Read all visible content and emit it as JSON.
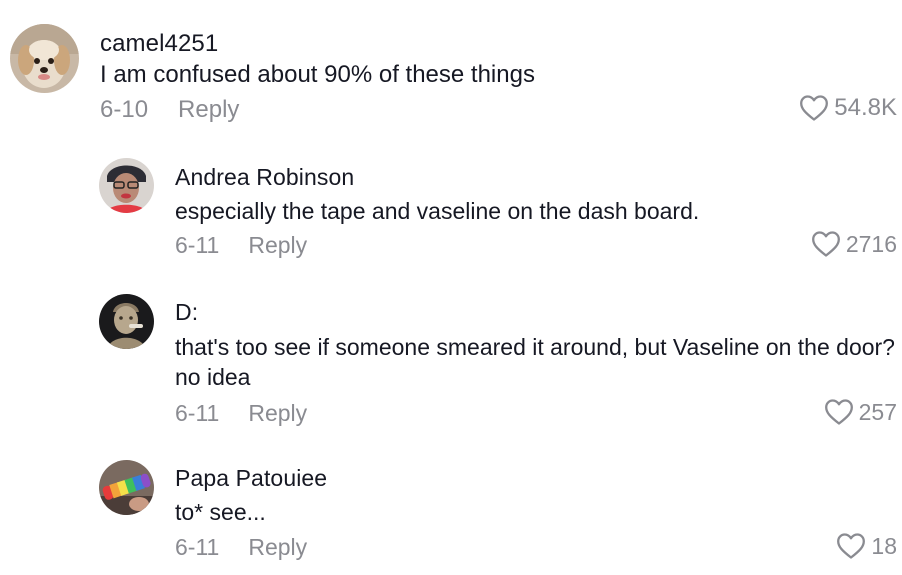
{
  "comments": [
    {
      "username": "camel4251",
      "text": "I am confused about 90% of these things",
      "date": "6-10",
      "reply_label": "Reply",
      "likes": "54.8K",
      "avatar": "dog-avatar"
    },
    {
      "username": "Andrea Robinson",
      "text": "especially the tape and vaseline on the dash board.",
      "date": "6-11",
      "reply_label": "Reply",
      "likes": "2716",
      "avatar": "person-avatar"
    },
    {
      "username": "D:",
      "text": "that's too see if someone smeared it around, but Vaseline on the door? no idea",
      "date": "6-11",
      "reply_label": "Reply",
      "likes": "257",
      "avatar": "statue-avatar"
    },
    {
      "username": "Papa Patouiee",
      "text": "to* see...",
      "date": "6-11",
      "reply_label": "Reply",
      "likes": "18",
      "avatar": "rainbow-avatar"
    }
  ],
  "colors": {
    "text": "#161823",
    "muted": "#8a8b91",
    "background": "#ffffff"
  },
  "icons": {
    "like": "heart-outline-icon"
  }
}
